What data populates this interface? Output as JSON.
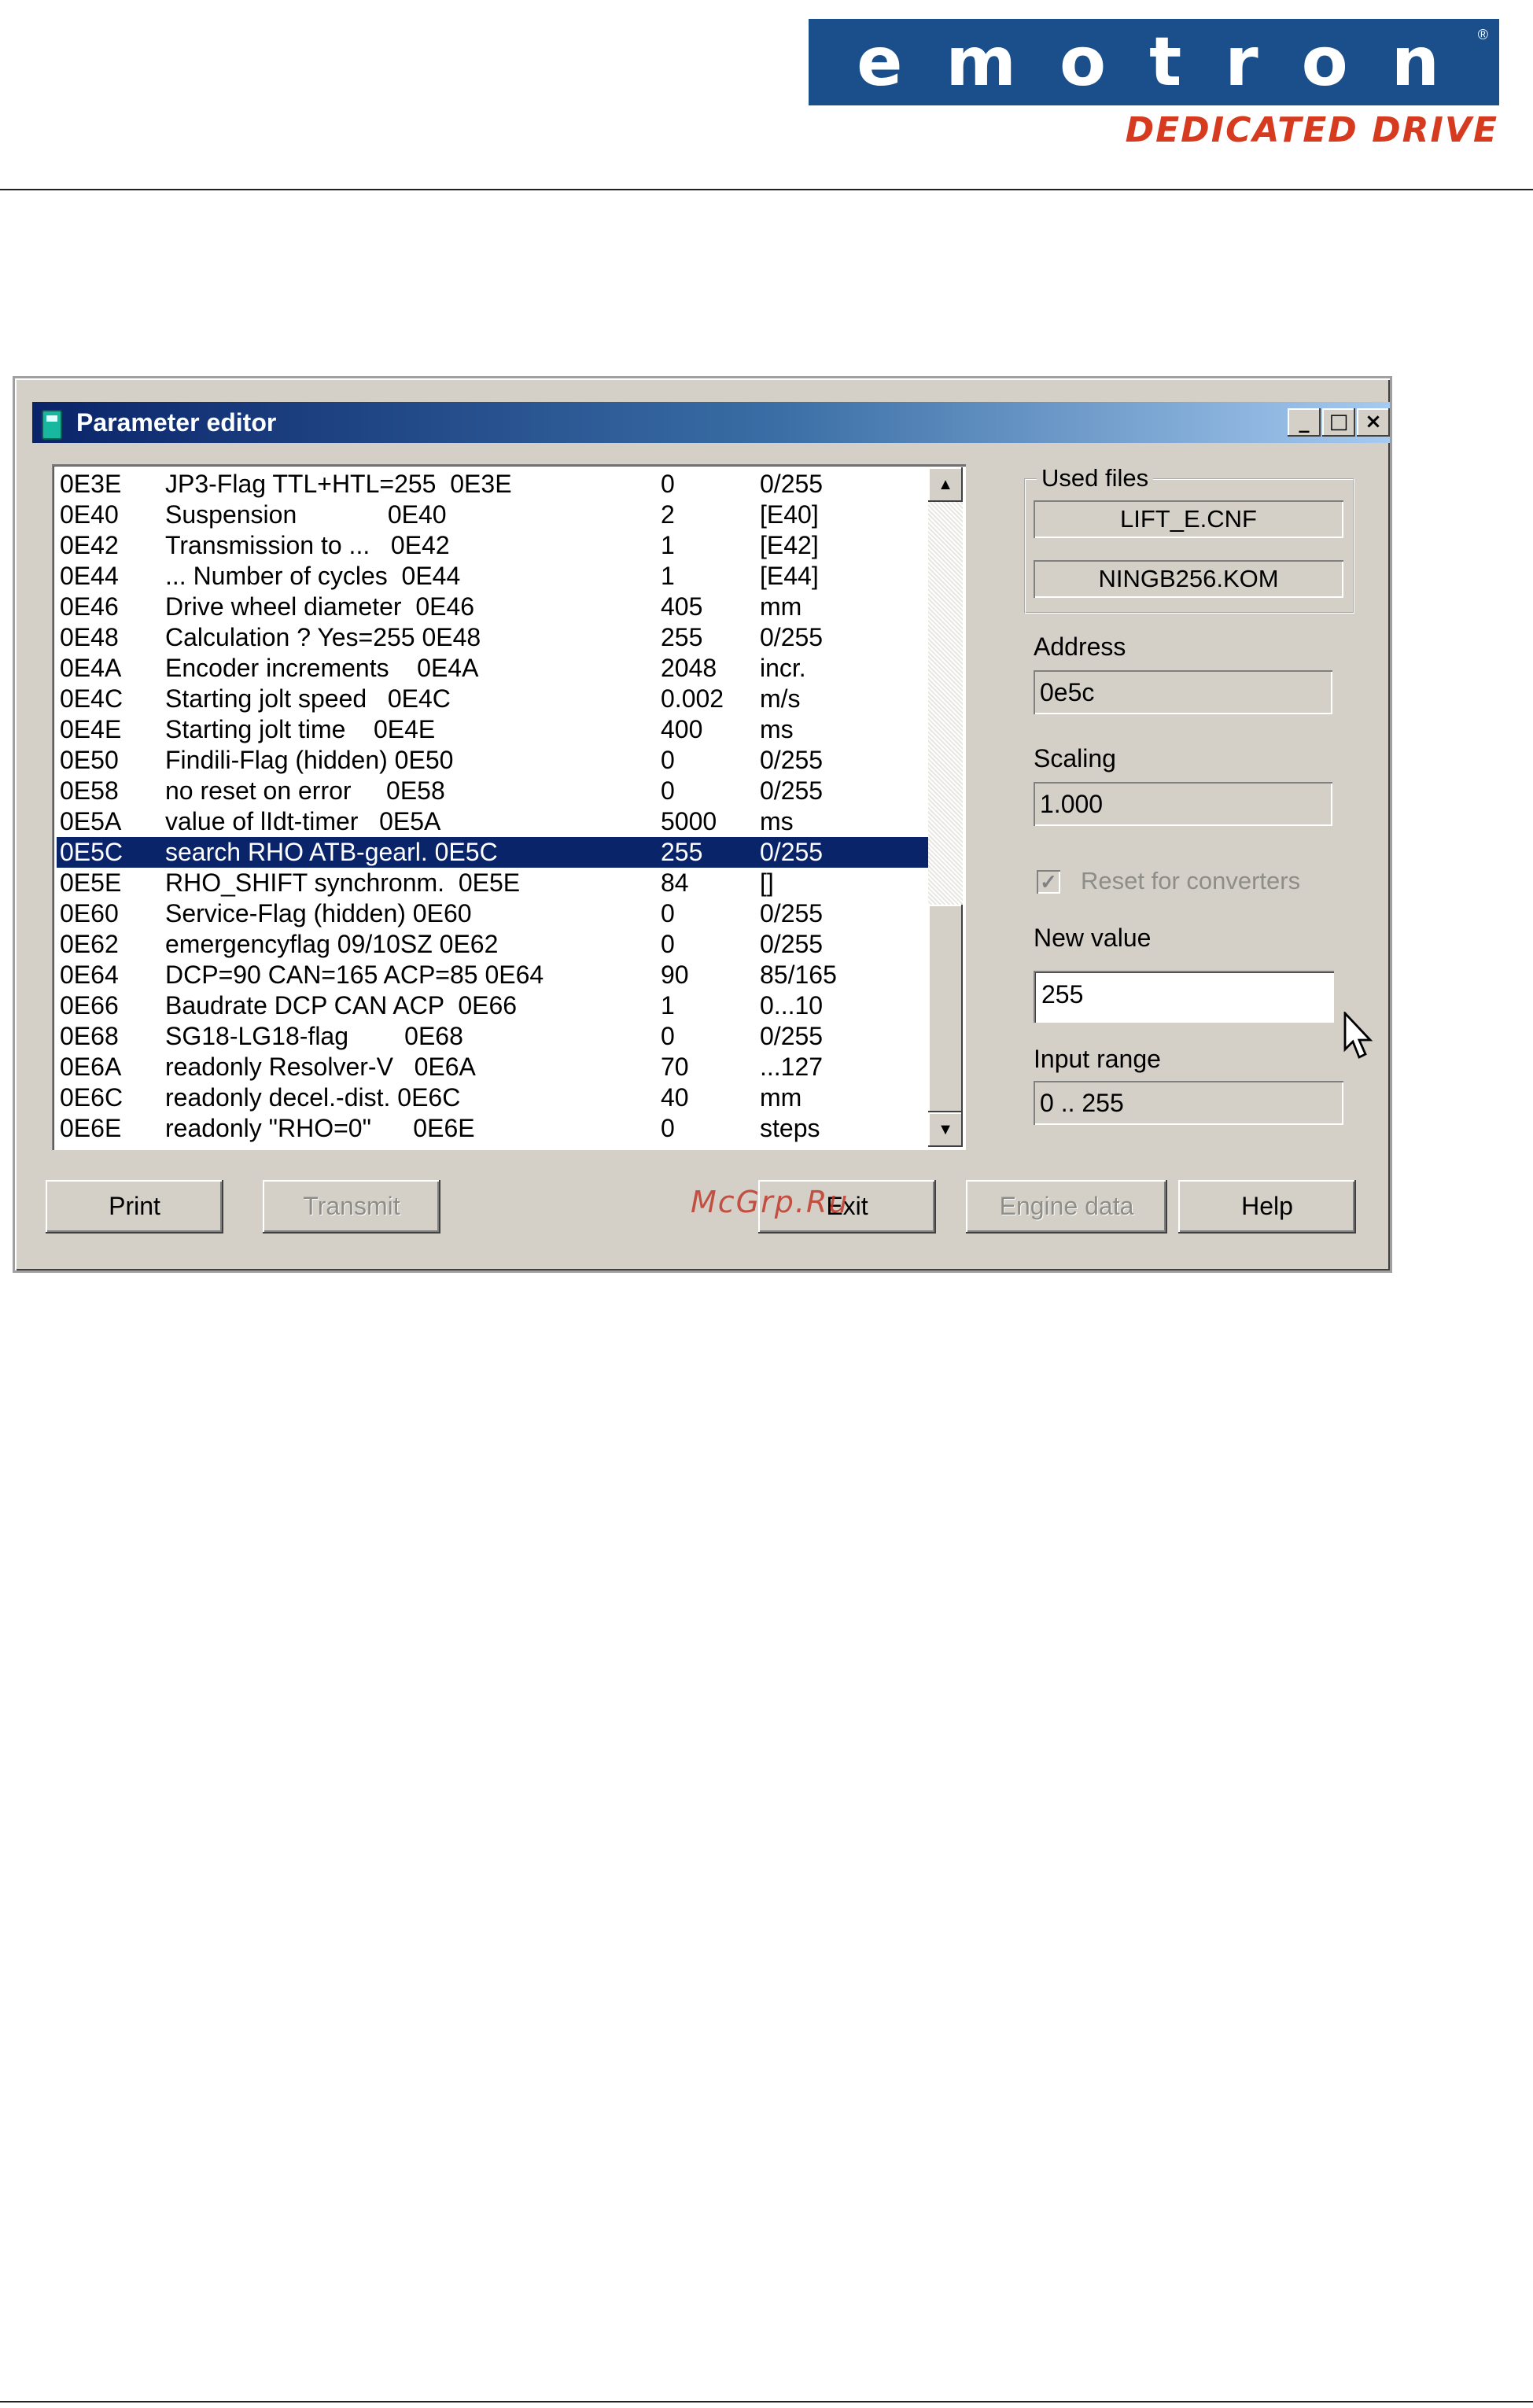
{
  "brand": {
    "name": "emotron",
    "registered": "®",
    "tagline": "DEDICATED DRIVE"
  },
  "window": {
    "title": "Parameter editor",
    "minimize": "_",
    "maximize": "□",
    "close": "×"
  },
  "parameters": [
    {
      "code": "0E3E",
      "desc": "JP3-Flag TTL+HTL=255  0E3E",
      "value": "0",
      "unit": "0/255"
    },
    {
      "code": "0E40",
      "desc": "Suspension             0E40",
      "value": "2",
      "unit": "[E40]"
    },
    {
      "code": "0E42",
      "desc": "Transmission to ...   0E42",
      "value": "1",
      "unit": "[E42]"
    },
    {
      "code": "0E44",
      "desc": "... Number of cycles  0E44",
      "value": "1",
      "unit": "[E44]"
    },
    {
      "code": "0E46",
      "desc": "Drive wheel diameter  0E46",
      "value": "405",
      "unit": "mm"
    },
    {
      "code": "0E48",
      "desc": "Calculation ? Yes=255 0E48",
      "value": "255",
      "unit": "0/255"
    },
    {
      "code": "0E4A",
      "desc": "Encoder increments    0E4A",
      "value": "2048",
      "unit": "incr."
    },
    {
      "code": "0E4C",
      "desc": "Starting jolt speed   0E4C",
      "value": "0.002",
      "unit": "m/s"
    },
    {
      "code": "0E4E",
      "desc": "Starting jolt time    0E4E",
      "value": "400",
      "unit": "ms"
    },
    {
      "code": "0E50",
      "desc": "Findili-Flag (hidden) 0E50",
      "value": "0",
      "unit": "0/255"
    },
    {
      "code": "0E58",
      "desc": "no reset on error     0E58",
      "value": "0",
      "unit": "0/255"
    },
    {
      "code": "0E5A",
      "desc": "value of lIdt-timer   0E5A",
      "value": "5000",
      "unit": "ms"
    },
    {
      "code": "0E5C",
      "desc": "search RHO ATB-gearl. 0E5C",
      "value": "255",
      "unit": "0/255",
      "selected": true
    },
    {
      "code": "0E5E",
      "desc": "RHO_SHIFT synchronm.  0E5E",
      "value": "84",
      "unit": "[]"
    },
    {
      "code": "0E60",
      "desc": "Service-Flag (hidden) 0E60",
      "value": "0",
      "unit": "0/255"
    },
    {
      "code": "0E62",
      "desc": "emergencyflag 09/10SZ 0E62",
      "value": "0",
      "unit": "0/255"
    },
    {
      "code": "0E64",
      "desc": "DCP=90 CAN=165 ACP=85 0E64",
      "value": "90",
      "unit": "85/165"
    },
    {
      "code": "0E66",
      "desc": "Baudrate DCP CAN ACP  0E66",
      "value": "1",
      "unit": "0...10"
    },
    {
      "code": "0E68",
      "desc": "SG18-LG18-flag        0E68",
      "value": "0",
      "unit": "0/255"
    },
    {
      "code": "0E6A",
      "desc": "readonly Resolver-V   0E6A",
      "value": "70",
      "unit": "...127"
    },
    {
      "code": "0E6C",
      "desc": "readonly decel.-dist. 0E6C",
      "value": "40",
      "unit": "mm"
    },
    {
      "code": "0E6E",
      "desc": "readonly \"RHO=0\"      0E6E",
      "value": "0",
      "unit": "steps"
    }
  ],
  "scrollbar": {
    "up": "▲",
    "down": "▼"
  },
  "used_files": {
    "legend": "Used files",
    "file1": "LIFT_E.CNF",
    "file2": "NINGB256.KOM"
  },
  "address": {
    "label": "Address",
    "value": "0e5c"
  },
  "scaling": {
    "label": "Scaling",
    "value": "1.000"
  },
  "reset": {
    "label": "Reset for converters",
    "checked": true,
    "check_glyph": "✓"
  },
  "new_value": {
    "label": "New value",
    "value": "255"
  },
  "input_range": {
    "label": "Input range",
    "value": "0 .. 255"
  },
  "buttons": {
    "print": "Print",
    "transmit": "Transmit",
    "exit": "Exit",
    "engine_data": "Engine data",
    "help": "Help"
  },
  "watermark": "McGrp.Ru"
}
